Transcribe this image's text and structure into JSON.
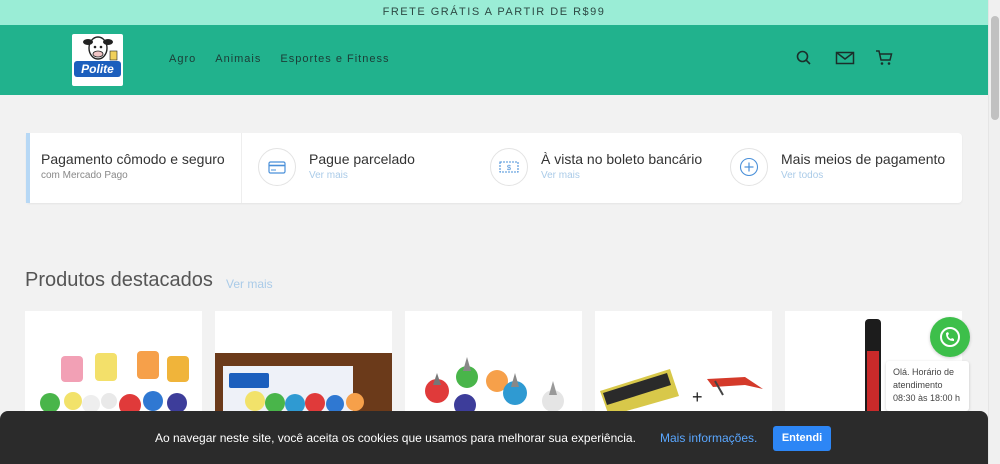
{
  "topbar": {
    "text": "FRETE GRÁTIS A PARTIR DE R$99"
  },
  "header": {
    "logo_text": "Polite",
    "logo_subtext": "",
    "nav": [
      "Agro",
      "Animais",
      "Esportes e Fitness"
    ],
    "icons": [
      "search-icon",
      "mail-icon",
      "cart-icon"
    ],
    "bg_color": "#21b28d"
  },
  "payment": {
    "first_title": "Pagamento cômodo e seguro",
    "first_sub": "com Mercado Pago",
    "items": [
      {
        "title": "Pague parcelado",
        "link": "Ver mais",
        "icon": "credit-card-icon"
      },
      {
        "title": "À vista no boleto bancário",
        "link": "Ver mais",
        "icon": "boleto-icon"
      },
      {
        "title": "Mais meios de pagamento",
        "link": "Ver todos",
        "icon": "plus-circle-icon"
      }
    ]
  },
  "featured": {
    "title": "Produtos destacados",
    "link": "Ver mais"
  },
  "whatsapp": {
    "bubble_lines": [
      "Olá. Horário de",
      "atendimento",
      "08:30 às 18:00 h"
    ]
  },
  "cookie": {
    "message": "Ao navegar neste site, você aceita os cookies que usamos para melhorar sua experiência.",
    "more": "Mais informações.",
    "accept": "Entendi"
  }
}
